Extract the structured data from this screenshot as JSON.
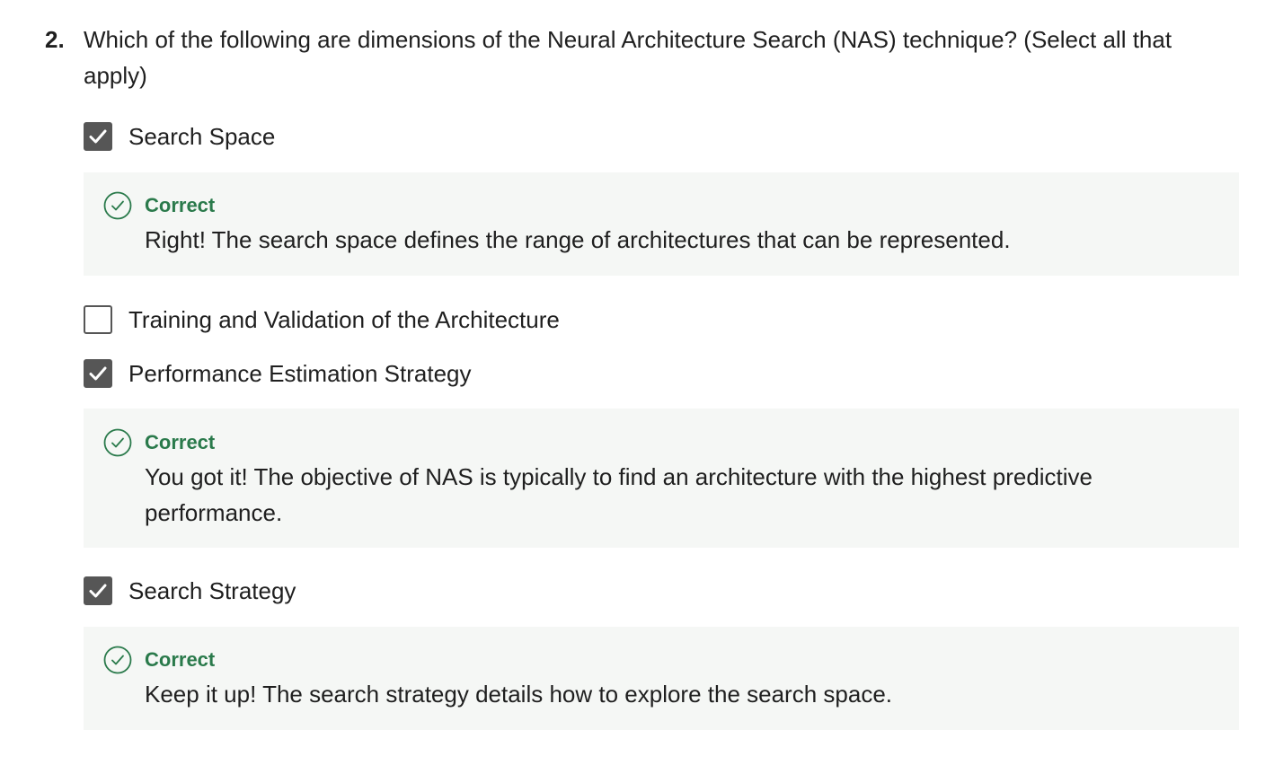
{
  "question": {
    "number": "2.",
    "text": "Which of the following are dimensions of the Neural Architecture Search (NAS) technique? (Select all that apply)"
  },
  "options": [
    {
      "label": "Search Space",
      "checked": true,
      "feedback": {
        "status": "Correct",
        "text": "Right! The search space defines the range of architectures that can be represented."
      }
    },
    {
      "label": "Training and Validation of the Architecture",
      "checked": false
    },
    {
      "label": "Performance Estimation Strategy",
      "checked": true,
      "feedback": {
        "status": "Correct",
        "text": "You got it! The objective of NAS is typically to find an architecture with the highest predictive performance."
      }
    },
    {
      "label": "Search Strategy",
      "checked": true,
      "feedback": {
        "status": "Correct",
        "text": "Keep it up! The search strategy details how to explore the search space."
      }
    }
  ],
  "colors": {
    "correct_green": "#2a7a4b",
    "checkbox_gray": "#565656",
    "feedback_bg": "#f5f7f5"
  },
  "icons": {
    "checkmark": "check-icon",
    "correct": "check-circle-icon"
  }
}
